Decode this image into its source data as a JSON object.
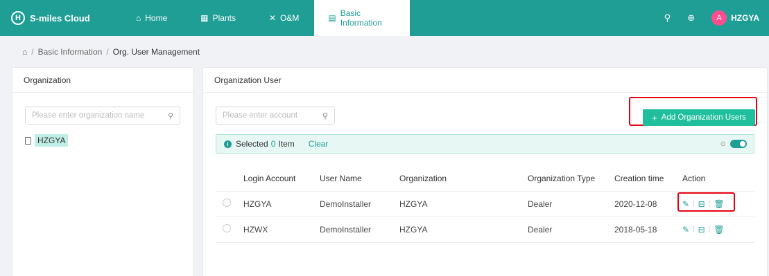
{
  "app": {
    "logo_mark": "H",
    "title": "S-miles Cloud"
  },
  "nav": [
    {
      "label": "Home",
      "icon": "home-icon",
      "glyph": "⌂"
    },
    {
      "label": "Plants",
      "icon": "grid-icon",
      "glyph": "▦"
    },
    {
      "label": "O&M",
      "icon": "tools-icon",
      "glyph": "✕"
    },
    {
      "label": "Basic Information",
      "icon": "list-icon",
      "glyph": "▤"
    }
  ],
  "header": {
    "search_icon": "search-icon",
    "language_icon": "globe-icon",
    "avatar_glyph": "A",
    "user": "HZGYA"
  },
  "breadcrumb": {
    "home_icon": "home-icon",
    "section": "Basic Information",
    "current": "Org. User Management"
  },
  "org_panel": {
    "title": "Organization",
    "search_placeholder": "Please enter organization name",
    "tree": [
      "HZGYA"
    ]
  },
  "user_panel": {
    "title": "Organization User",
    "search_placeholder": "Please enter account",
    "add_button": "Add Organization Users",
    "selection": {
      "prefix": "Selected",
      "count": "0",
      "suffix": "Item",
      "clear": "Clear"
    },
    "columns": [
      "Login Account",
      "User Name",
      "Organization",
      "Organization Type",
      "Creation time",
      "Action"
    ],
    "rows": [
      {
        "account": "HZGYA",
        "user": "DemoInstaller",
        "org": "HZGYA",
        "type": "Dealer",
        "created": "2020-12-08"
      },
      {
        "account": "HZWX",
        "user": "DemoInstaller",
        "org": "HZGYA",
        "type": "Dealer",
        "created": "2018-05-18"
      }
    ]
  },
  "colors": {
    "brand": "#1f9e96",
    "button": "#1fbf9d",
    "highlight": "#e60012"
  }
}
